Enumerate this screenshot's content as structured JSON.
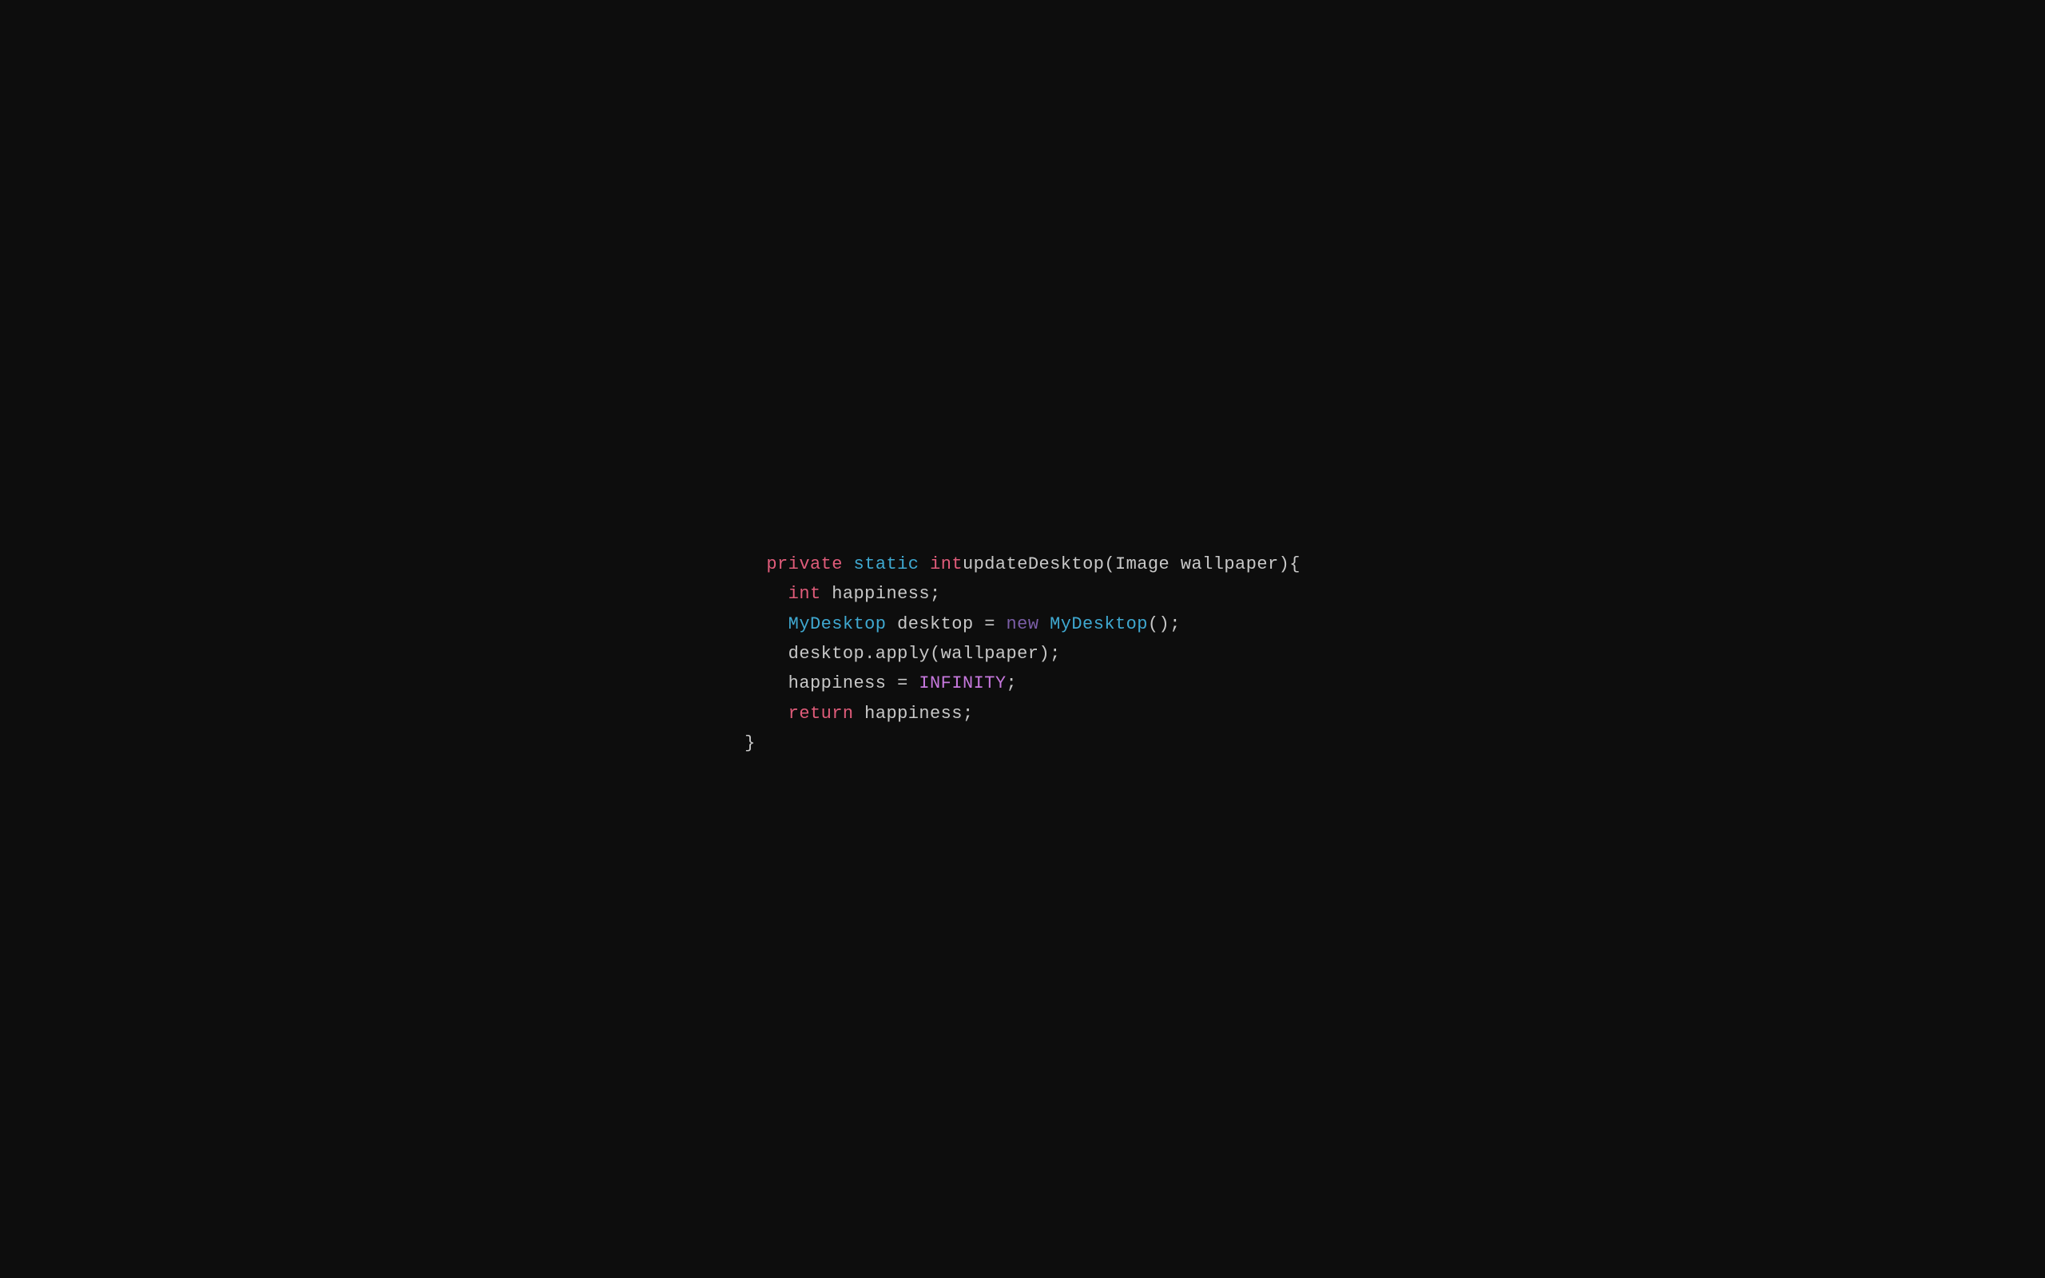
{
  "code": {
    "line1": {
      "private": "private",
      "space1": " ",
      "static": "static",
      "space2": " ",
      "int": "int",
      "space3": " ",
      "rest": "updateDesktop(Image wallpaper){"
    },
    "line2": {
      "indent": "    ",
      "int": "int",
      "rest": " happiness;"
    },
    "line3": {
      "indent": "    ",
      "mydesktop1": "MyDesktop",
      "rest1": " desktop = ",
      "new": "new",
      "space": " ",
      "mydesktop2": "MyDesktop",
      "rest2": "();"
    },
    "line4": {
      "indent": "    ",
      "rest": "desktop.apply(wallpaper);"
    },
    "line5": {
      "indent": "    ",
      "rest1": "happiness = ",
      "infinity": "INFINITY",
      "rest2": ";"
    },
    "line6": {
      "indent": "    ",
      "return": "return",
      "rest": " happiness;"
    },
    "line7": {
      "brace": "}"
    }
  },
  "colors": {
    "background": "#0d0d0d",
    "keyword": "#e05c7a",
    "class": "#3fa8d0",
    "constant": "#c678dd",
    "new_keyword": "#7b5ea7",
    "normal": "#c8c8c8"
  }
}
